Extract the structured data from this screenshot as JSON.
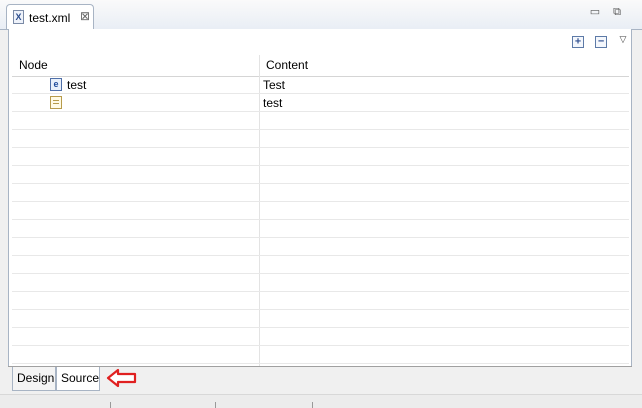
{
  "editor": {
    "tab_title": "test.xml",
    "icons": {
      "file": "xml-file-icon",
      "close": "close-icon",
      "minimize": "minimize-icon",
      "restore": "restore-icon",
      "expand_all": "expand-all-icon",
      "collapse_all": "collapse-all-icon",
      "view_menu": "view-menu-icon"
    }
  },
  "table": {
    "columns": [
      "Node",
      "Content"
    ],
    "rows": [
      {
        "node": "test",
        "node_icon": "element-icon",
        "content": "Test"
      },
      {
        "node": "",
        "node_icon": "text-node-icon",
        "content": "test"
      }
    ]
  },
  "bottom_tabs": [
    {
      "label": "Design",
      "active": false
    },
    {
      "label": "Source",
      "active": true
    }
  ],
  "annotation": {
    "icon": "red-arrow-icon",
    "color": "#e02020"
  }
}
